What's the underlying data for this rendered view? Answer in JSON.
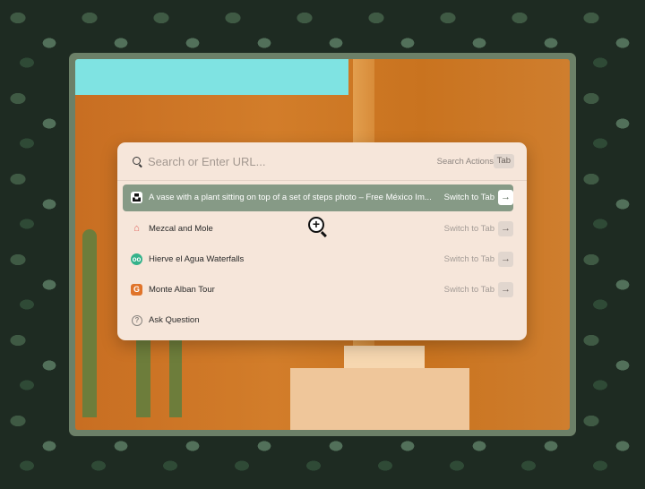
{
  "search": {
    "placeholder": "Search or Enter URL...",
    "actions_label": "Search Actions",
    "tab_key": "Tab"
  },
  "results": [
    {
      "icon": "unsplash-icon",
      "label": "A vase with a plant sitting on top of a set of steps photo – Free México Im...",
      "action": "Switch to Tab",
      "selected": true,
      "icon_color": "#111111"
    },
    {
      "icon": "airbnb-icon",
      "label": "Mezcal and Mole",
      "action": "Switch to Tab",
      "selected": false,
      "icon_color": "#e0605a"
    },
    {
      "icon": "tripadvisor-icon",
      "label": "Hierve el Agua Waterfalls",
      "action": "Switch to Tab",
      "selected": false,
      "icon_color": "#34b28a"
    },
    {
      "icon": "getyourguide-icon",
      "label": "Monte Alban Tour",
      "action": "Switch to Tab",
      "selected": false,
      "icon_color": "#e0742a"
    },
    {
      "icon": "question-icon",
      "label": "Ask Question",
      "action": "",
      "selected": false,
      "icon_color": "#8a8580"
    }
  ]
}
